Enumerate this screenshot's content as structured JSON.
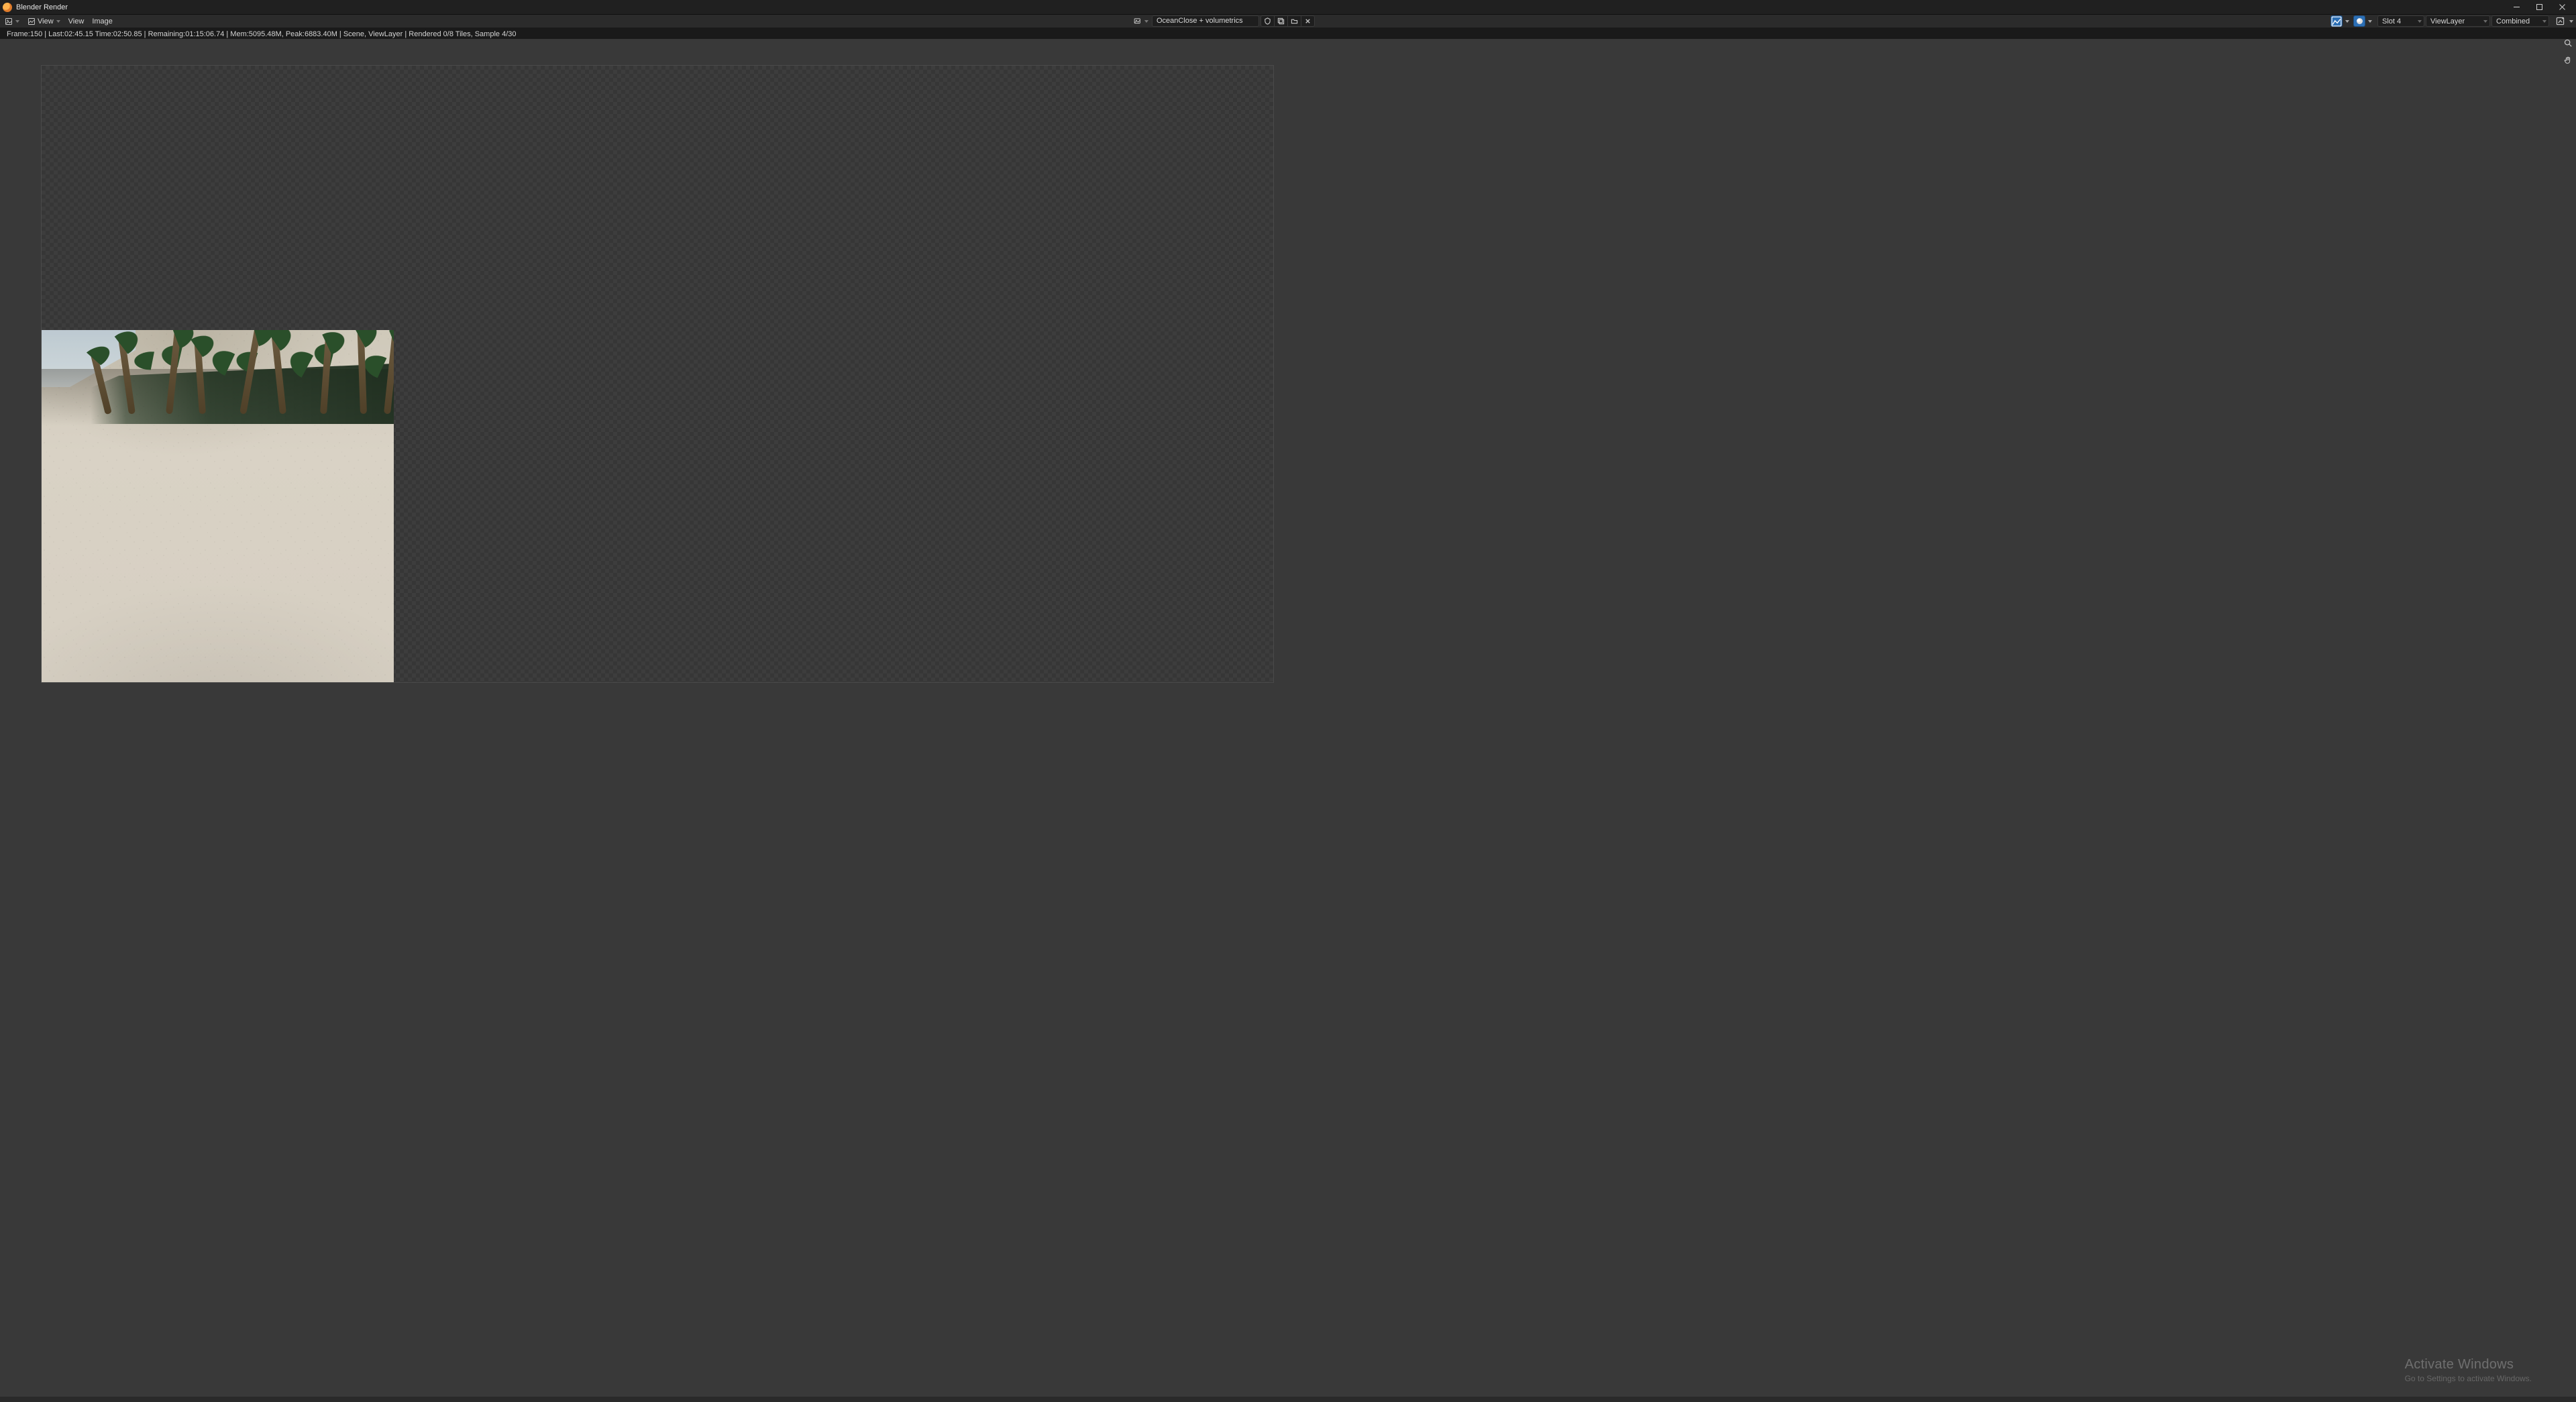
{
  "titlebar": {
    "title": "Blender Render"
  },
  "header": {
    "menu_view_dropdown": "View",
    "menu_view": "View",
    "menu_image": "Image",
    "image_name": "OceanClose + volumetrics",
    "slot": "Slot 4",
    "layer": "ViewLayer",
    "pass": "Combined"
  },
  "status": {
    "text": "Frame:150 | Last:02:45.15 Time:02:50.85 | Remaining:01:15:06.74 | Mem:5095.48M, Peak:6883.40M | Scene, ViewLayer | Rendered 0/8 Tiles, Sample 4/30"
  },
  "watermark": {
    "title": "Activate Windows",
    "sub": "Go to Settings to activate Windows."
  }
}
